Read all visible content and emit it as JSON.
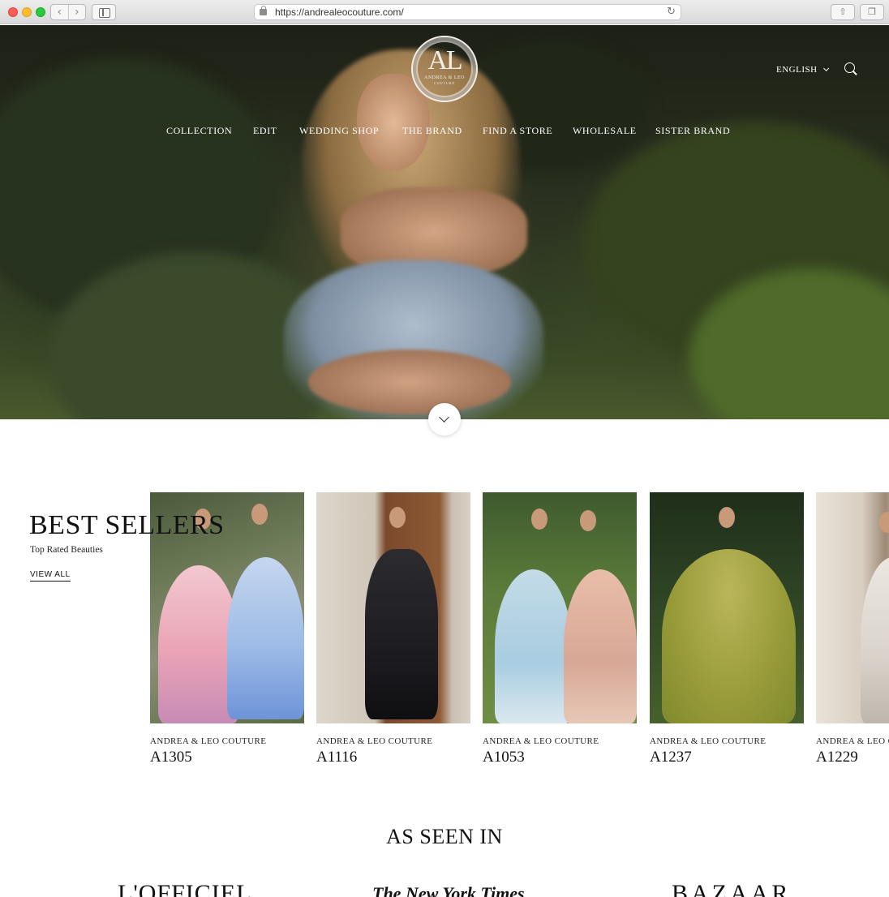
{
  "browser": {
    "url": "https://andrealeocouture.com/",
    "back_glyph": "‹",
    "forward_glyph": "›",
    "reload_glyph": "↻",
    "share_glyph": "⇧",
    "tabs_glyph": "❐"
  },
  "header": {
    "logo": {
      "monogram": "AL",
      "name": "ANDREA & LEO",
      "sub": "COUTURE"
    },
    "language": "ENGLISH",
    "nav": [
      "COLLECTION",
      "EDIT",
      "WEDDING SHOP",
      "THE BRAND",
      "FIND A STORE",
      "WHOLESALE",
      "SISTER BRAND"
    ]
  },
  "best_sellers": {
    "title": "BEST SELLERS",
    "subtitle": "Top Rated Beauties",
    "link": "VIEW ALL",
    "products": [
      {
        "brand": "ANDREA & LEO COUTURE",
        "code": "A1305"
      },
      {
        "brand": "ANDREA & LEO COUTURE",
        "code": "A1116"
      },
      {
        "brand": "ANDREA & LEO COUTURE",
        "code": "A1053"
      },
      {
        "brand": "ANDREA & LEO COUTURE",
        "code": "A1237"
      },
      {
        "brand": "ANDREA & LEO COUTURE",
        "code": "A1229"
      }
    ]
  },
  "as_seen_in": {
    "title": "AS SEEN IN",
    "logos": [
      "L'OFFICIEL",
      "The New York Times",
      "BAZAAR"
    ]
  }
}
